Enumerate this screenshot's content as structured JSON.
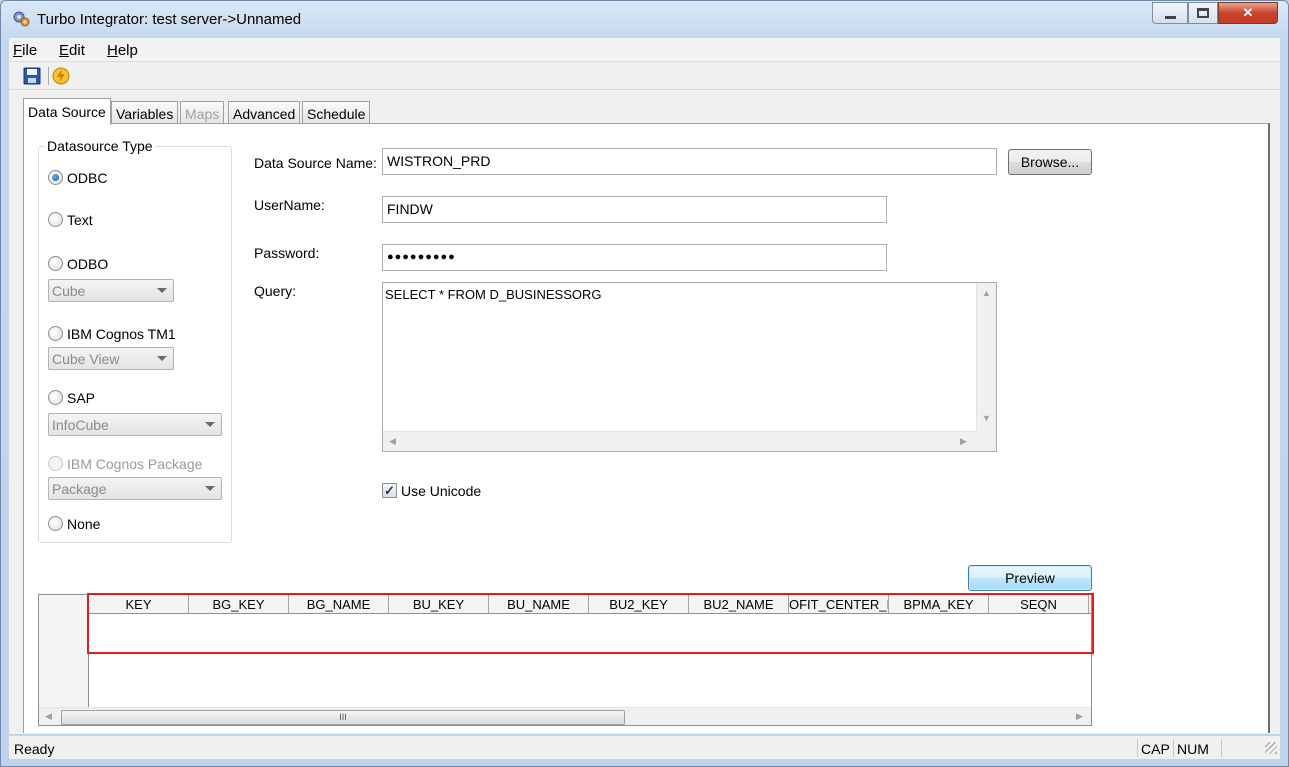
{
  "window": {
    "title": "Turbo Integrator:  test server->Unnamed"
  },
  "menu": {
    "file": "File",
    "edit": "Edit",
    "help": "Help"
  },
  "toolbar": {
    "icons": [
      "save-icon",
      "run-process-icon"
    ]
  },
  "tabs": [
    "Data Source",
    "Variables",
    "Maps",
    "Advanced",
    "Schedule"
  ],
  "datasource_type": {
    "legend": "Datasource Type",
    "selected": "ODBC",
    "options": [
      "ODBC",
      "Text",
      "ODBO",
      "IBM Cognos TM1",
      "SAP",
      "IBM Cognos Package",
      "None"
    ],
    "combos": {
      "odbo": "Cube",
      "tm1": "Cube View",
      "sap": "InfoCube",
      "package": "Package"
    }
  },
  "form": {
    "ds_name_label": "Data Source Name:",
    "ds_name_value": "WISTRON_PRD",
    "browse_label": "Browse...",
    "username_label": "UserName:",
    "username_value": "FINDW",
    "password_label": "Password:",
    "password_value": "●●●●●●●●●",
    "query_label": "Query:",
    "query_value": "SELECT * FROM D_BUSINESSORG",
    "use_unicode_label": "Use Unicode",
    "use_unicode_checked": true
  },
  "preview": {
    "label": "Preview"
  },
  "grid": {
    "columns": [
      "KEY",
      "BG_KEY",
      "BG_NAME",
      "BU_KEY",
      "BU_NAME",
      "BU2_KEY",
      "BU2_NAME",
      "OFIT_CENTER_I",
      "BPMA_KEY",
      "SEQN"
    ],
    "scroll_thumb": "III",
    "highlight_color": "#e31b1b"
  },
  "status": {
    "text": "Ready",
    "cap": "CAP",
    "num": "NUM"
  }
}
